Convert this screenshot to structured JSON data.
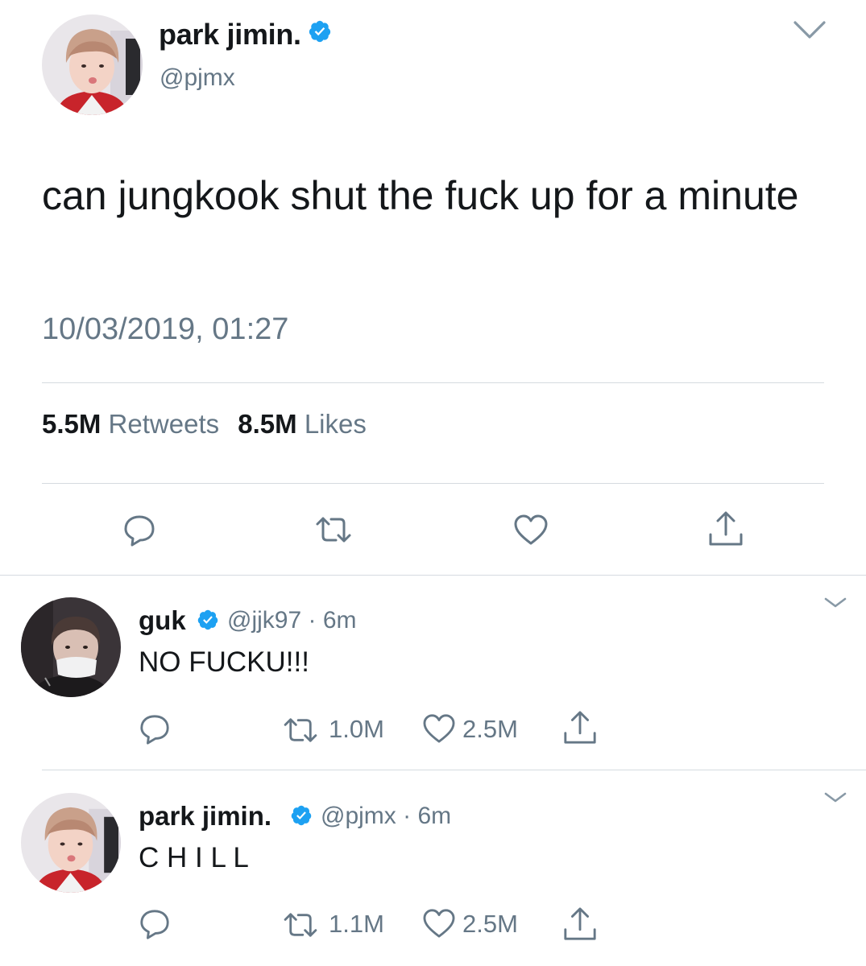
{
  "main_tweet": {
    "display_name": "park jimin.",
    "handle": "@pjmx",
    "text": "can jungkook shut the fuck up for a minute",
    "timestamp": "10/03/2019, 01:27",
    "retweets_count": "5.5M",
    "retweets_label": "Retweets",
    "likes_count": "8.5M",
    "likes_label": "Likes"
  },
  "replies": [
    {
      "display_name": "guk",
      "handle": "@jjk97",
      "separator": "·",
      "time": "6m",
      "text": "NO FUCKU!!!",
      "retweets": "1.0M",
      "likes": "2.5M"
    },
    {
      "display_name": "park jimin.",
      "handle": "@pjmx",
      "separator": "·",
      "time": "6m",
      "text": "C H I L L",
      "retweets": "1.1M",
      "likes": "2.5M"
    }
  ],
  "icons": {
    "verified": "verified-badge-icon",
    "reply": "speech-bubble-icon",
    "retweet": "retweet-arrows-icon",
    "like": "heart-icon",
    "share": "share-arrow-up-icon",
    "menu": "chevron-down-icon"
  },
  "colors": {
    "verified_blue": "#1da1f2",
    "secondary_text": "#657786",
    "primary_text": "#14171a",
    "icon_gray": "#657786",
    "divider": "#d5dbe0"
  }
}
